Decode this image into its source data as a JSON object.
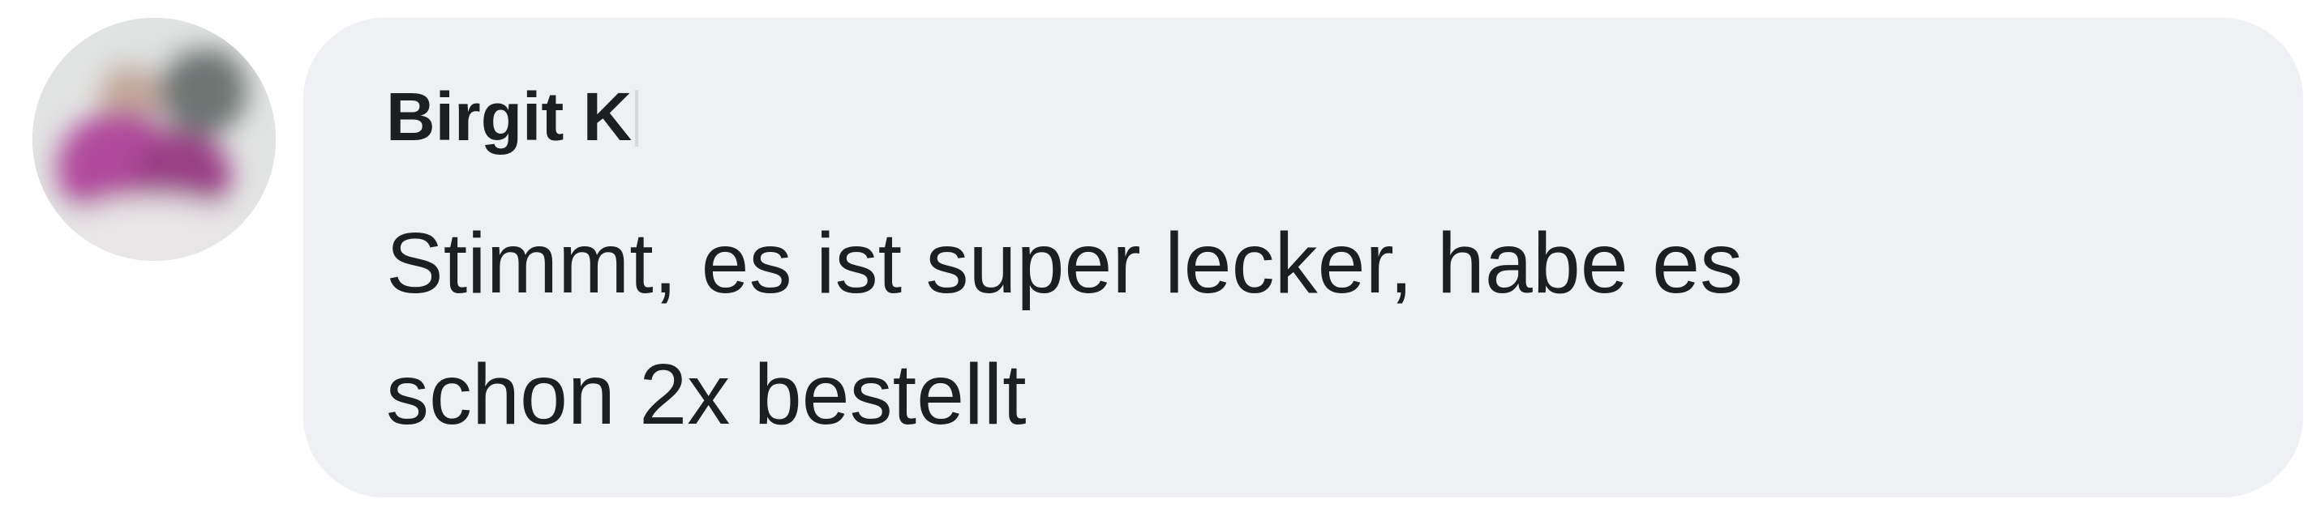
{
  "comment": {
    "author": "Birgit K",
    "text_line1": "Stimmt, es ist super lecker, habe es",
    "text_line2": "schon 2x bestellt",
    "avatar_icon": "blurred-profile-photo",
    "colors": {
      "bubble_background": "#eff0f4",
      "text": "#1c1e21",
      "page_background": "#ffffff"
    }
  }
}
